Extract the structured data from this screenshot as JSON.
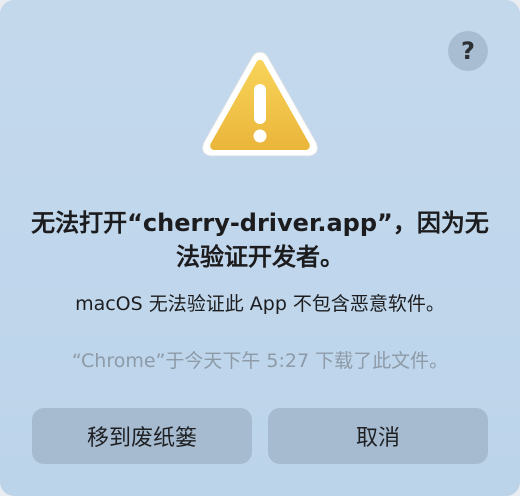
{
  "dialog": {
    "title": "无法打开“cherry-driver.app”，因为无法验证开发者。",
    "message": "macOS 无法验证此 App 不包含恶意软件。",
    "detail": "“Chrome”于今天下午 5:27 下载了此文件。",
    "help_label": "?",
    "icon": "warning-triangle-icon",
    "colors": {
      "background": "#c1d7ec",
      "button": "#a6bbd0",
      "warning_yellow": "#f2c84b"
    }
  },
  "buttons": {
    "move_to_trash": "移到废纸篓",
    "cancel": "取消"
  }
}
